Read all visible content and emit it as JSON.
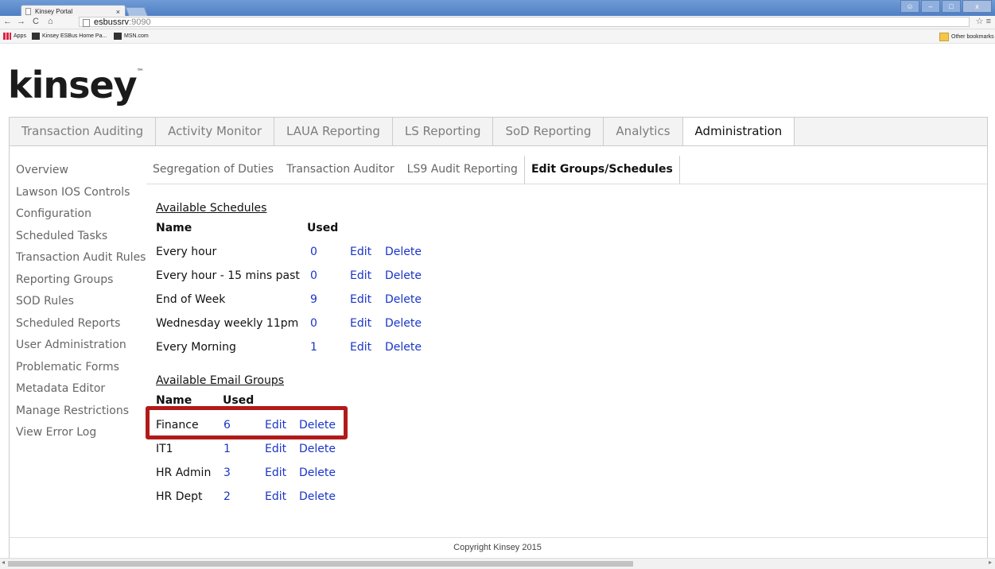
{
  "browser": {
    "tab_title": "Kinsey Portal",
    "tab_close": "×",
    "url_host": "esbussrv",
    "url_port": ":9090",
    "bookmarks": [
      "Apps",
      "Kinsey ESBus Home Pa...",
      "MSN.com"
    ],
    "other_bookmarks": "Other bookmarks"
  },
  "logo": {
    "text": "kinsey",
    "tm": "™"
  },
  "main_nav": [
    "Transaction Auditing",
    "Activity Monitor",
    "LAUA Reporting",
    "LS Reporting",
    "SoD Reporting",
    "Analytics",
    "Administration"
  ],
  "main_nav_active": "Administration",
  "sidebar": [
    "Overview",
    "Lawson IOS Controls",
    "Configuration",
    "Scheduled Tasks",
    "Transaction Audit Rules",
    "Reporting Groups",
    "SOD Rules",
    "Scheduled Reports",
    "User Administration",
    "Problematic Forms",
    "Metadata Editor",
    "Manage Restrictions",
    "View Error Log"
  ],
  "sub_nav": [
    "Segregation of Duties",
    "Transaction Auditor",
    "LS9 Audit Reporting",
    "Edit Groups/Schedules"
  ],
  "sub_nav_active": "Edit Groups/Schedules",
  "schedules": {
    "heading": "Available Schedules",
    "col_name": "Name",
    "col_used": "Used",
    "rows": [
      {
        "name": "Every hour",
        "used": "0",
        "edit": "Edit",
        "delete": "Delete"
      },
      {
        "name": "Every hour - 15 mins past",
        "used": "0",
        "edit": "Edit",
        "delete": "Delete"
      },
      {
        "name": "End of Week",
        "used": "9",
        "edit": "Edit",
        "delete": "Delete"
      },
      {
        "name": "Wednesday weekly 11pm",
        "used": "0",
        "edit": "Edit",
        "delete": "Delete"
      },
      {
        "name": "Every Morning",
        "used": "1",
        "edit": "Edit",
        "delete": "Delete"
      }
    ]
  },
  "email_groups": {
    "heading": "Available Email Groups",
    "col_name": "Name",
    "col_used": "Used",
    "rows": [
      {
        "name": "Finance",
        "used": "6",
        "edit": "Edit",
        "delete": "Delete"
      },
      {
        "name": "IT1",
        "used": "1",
        "edit": "Edit",
        "delete": "Delete"
      },
      {
        "name": "HR Admin",
        "used": "3",
        "edit": "Edit",
        "delete": "Delete"
      },
      {
        "name": "HR Dept",
        "used": "2",
        "edit": "Edit",
        "delete": "Delete"
      }
    ]
  },
  "footer": "Copyright Kinsey 2015",
  "colors": {
    "link": "#1a35c8",
    "highlight_border": "#b21a1a",
    "nav_bg": "#f3f3f3"
  }
}
